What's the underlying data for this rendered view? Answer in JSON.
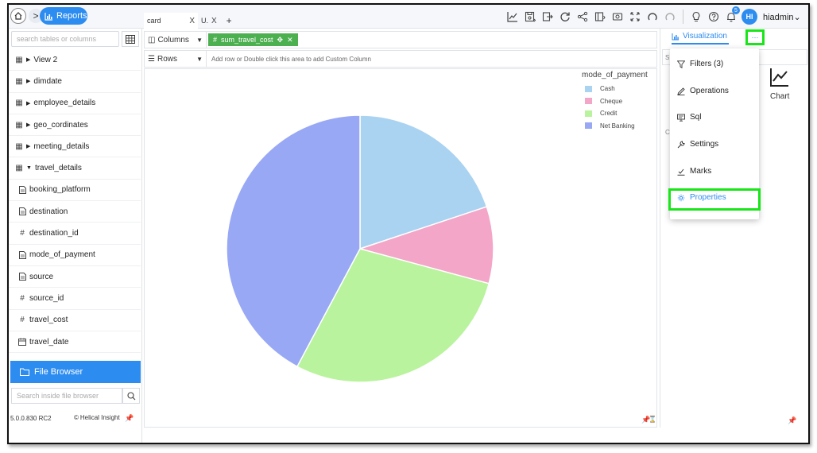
{
  "topbar": {
    "breadcrumb_label": "Reports",
    "tabs": [
      {
        "label": "card",
        "close": "X"
      },
      {
        "label": "U.",
        "close": "X"
      }
    ],
    "add_tab": "+",
    "notification_count": "5",
    "avatar_initials": "HI",
    "username": "hiadmin",
    "accent_color": "#2d8cf0"
  },
  "sidebar": {
    "search_placeholder": "search tables or columns",
    "tables": [
      {
        "label": "View 2",
        "icon": "table-icon",
        "expanded": false
      },
      {
        "label": "dimdate",
        "icon": "table-icon",
        "expanded": false
      },
      {
        "label": "employee_details",
        "icon": "table-icon",
        "expanded": false
      },
      {
        "label": "geo_cordinates",
        "icon": "table-icon",
        "expanded": false
      },
      {
        "label": "meeting_details",
        "icon": "table-icon",
        "expanded": false
      },
      {
        "label": "travel_details",
        "icon": "table-icon",
        "expanded": true
      }
    ],
    "columns": [
      {
        "label": "booking_platform",
        "icon": "text-field-icon"
      },
      {
        "label": "destination",
        "icon": "text-field-icon"
      },
      {
        "label": "destination_id",
        "icon": "number-field-icon"
      },
      {
        "label": "mode_of_payment",
        "icon": "text-field-icon"
      },
      {
        "label": "source",
        "icon": "text-field-icon"
      },
      {
        "label": "source_id",
        "icon": "number-field-icon"
      },
      {
        "label": "travel_cost",
        "icon": "number-field-icon"
      },
      {
        "label": "travel_date",
        "icon": "date-field-icon"
      }
    ],
    "file_browser_label": "File Browser",
    "file_search_placeholder": "Search inside file browser",
    "version": "5.0.0.830 RC2",
    "brand": "Helical Insight"
  },
  "shelves": {
    "columns_label": "Columns",
    "columns_pill": "sum_travel_cost",
    "rows_label": "Rows",
    "rows_hint": "Add row or Double click this area to add Custom Column"
  },
  "chart_data": {
    "type": "pie",
    "title": "",
    "legend_title": "mode_of_payment",
    "legend_position": "top-right",
    "categories": [
      "Cash",
      "Cheque",
      "Credit",
      "Net Banking"
    ],
    "values": [
      19.9,
      9.3,
      28.6,
      42.2
    ],
    "colors": [
      "#a9d3f1",
      "#f3a6c8",
      "#b9f39e",
      "#98a8f4"
    ]
  },
  "right_panel": {
    "tab_label": "Visualization",
    "more_label": "···",
    "partial_s": "S",
    "partial_c": "C",
    "chart_type_label": "Chart"
  },
  "dropdown": {
    "items": [
      {
        "label": "Filters (3)",
        "icon": "filter-icon"
      },
      {
        "label": "Operations",
        "icon": "pencil-icon"
      },
      {
        "label": "Sql",
        "icon": "sql-icon"
      },
      {
        "label": "Settings",
        "icon": "wrench-icon"
      },
      {
        "label": "Marks",
        "icon": "marks-icon"
      },
      {
        "label": "Properties",
        "icon": "gear-icon"
      }
    ],
    "highlight_color": "#19e619"
  }
}
